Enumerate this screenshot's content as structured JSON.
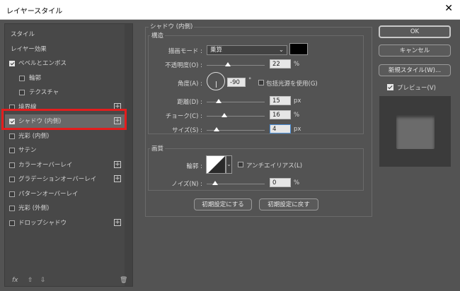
{
  "window": {
    "title": "レイヤースタイル",
    "close_glyph": "✕"
  },
  "left_panel": {
    "items": [
      {
        "label": "スタイル",
        "type": "header",
        "checked": false,
        "plus": false
      },
      {
        "label": "レイヤー効果",
        "type": "header",
        "checked": false,
        "plus": false
      },
      {
        "label": "ベベルとエンボス",
        "type": "item",
        "checked": true,
        "plus": false
      },
      {
        "label": "輪郭",
        "type": "sub",
        "checked": false,
        "plus": false
      },
      {
        "label": "テクスチャ",
        "type": "sub",
        "checked": false,
        "plus": false
      },
      {
        "label": "境界線",
        "type": "item",
        "checked": false,
        "plus": true
      },
      {
        "label": "シャドウ (内側)",
        "type": "item",
        "checked": true,
        "plus": true,
        "selected": true
      },
      {
        "label": "光彩 (内側)",
        "type": "item",
        "checked": false,
        "plus": false
      },
      {
        "label": "サテン",
        "type": "item",
        "checked": false,
        "plus": false
      },
      {
        "label": "カラーオーバーレイ",
        "type": "item",
        "checked": false,
        "plus": true
      },
      {
        "label": "グラデーションオーバーレイ",
        "type": "item",
        "checked": false,
        "plus": true
      },
      {
        "label": "パターンオーバーレイ",
        "type": "item",
        "checked": false,
        "plus": false
      },
      {
        "label": "光彩 (外側)",
        "type": "item",
        "checked": false,
        "plus": false
      },
      {
        "label": "ドロップシャドウ",
        "type": "item",
        "checked": false,
        "plus": true
      }
    ],
    "footer": {
      "fx": "fx",
      "up": "⇧",
      "down": "⇩",
      "trash": "🗑"
    }
  },
  "shadow_panel": {
    "group_title": "シャドウ (内側)",
    "structure_title": "構造",
    "blend_mode_label": "描画モード :",
    "blend_mode_value": "乗算",
    "shadow_color": "#000000",
    "opacity_label": "不透明度(O) :",
    "opacity_value": "22",
    "opacity_unit": "%",
    "opacity_level": 0.22,
    "angle_label": "角度(A) :",
    "angle_value": "-90",
    "angle_unit": "°",
    "global_light_label": "包括光源を使用(G)",
    "global_light_checked": false,
    "distance_label": "距離(D) :",
    "distance_value": "15",
    "distance_unit": "px",
    "distance_level": 0.06,
    "choke_label": "チョーク(C) :",
    "choke_value": "16",
    "choke_unit": "%",
    "choke_level": 0.16,
    "size_label": "サイズ(S) :",
    "size_value": "4",
    "size_unit": "px",
    "size_level": 0.02,
    "quality_title": "画質",
    "contour_label": "輪郭 :",
    "antialias_label": "アンチエイリアス(L)",
    "antialias_checked": false,
    "noise_label": "ノイズ(N) :",
    "noise_value": "0",
    "noise_unit": "%",
    "noise_level": 0.0,
    "reset_default_label": "初期設定にする",
    "restore_default_label": "初期設定に戻す"
  },
  "right_panel": {
    "ok_label": "OK",
    "cancel_label": "キャンセル",
    "new_style_label": "新規スタイル(W)...",
    "preview_label": "プレビュー(V)",
    "preview_checked": true
  }
}
